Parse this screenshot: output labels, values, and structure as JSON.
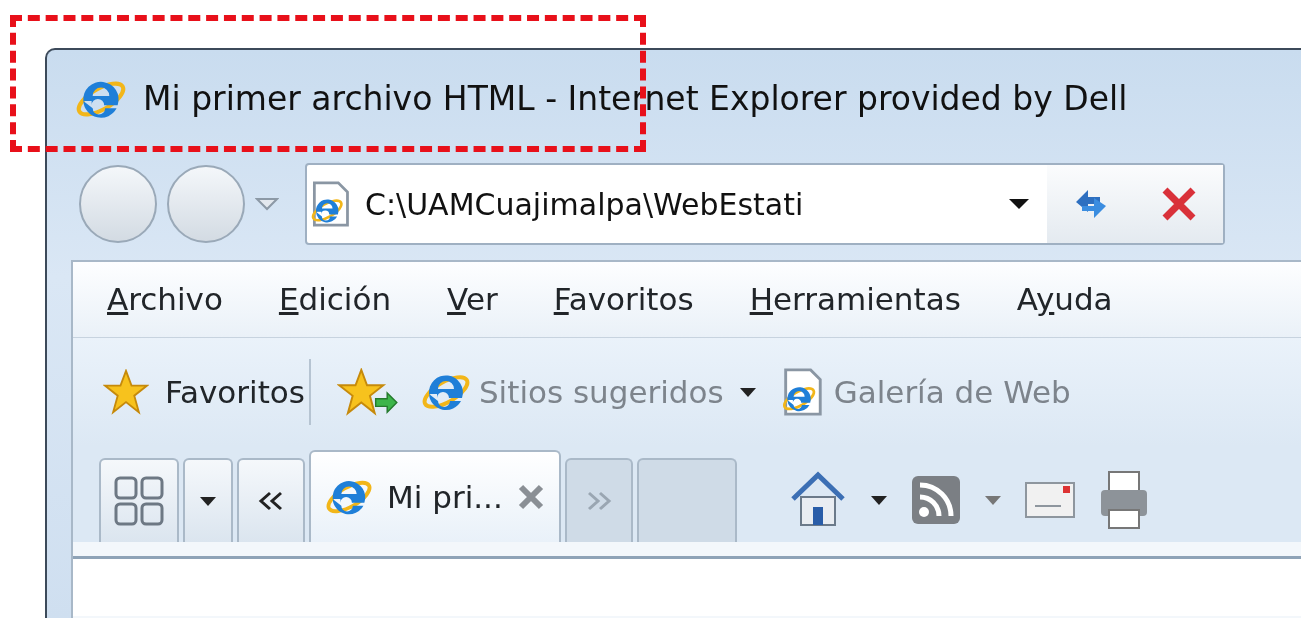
{
  "annotation": {
    "kind": "dashed-box"
  },
  "window": {
    "title": "Mi primer archivo HTML - Internet Explorer provided by Dell"
  },
  "address_bar": {
    "value": "C:\\UAMCuajimalpa\\WebEstati"
  },
  "menu": [
    {
      "key": "A",
      "after": "rchivo"
    },
    {
      "key": "E",
      "after": "dición"
    },
    {
      "key": "V",
      "after": "er"
    },
    {
      "key": "F",
      "after": "avoritos"
    },
    {
      "key": "H",
      "after": "erramientas"
    },
    {
      "before": "A",
      "key": "y",
      "after": "uda"
    }
  ],
  "favorites_bar": [
    {
      "kind": "favorites",
      "label": "Favoritos"
    },
    {
      "kind": "add-favorite"
    },
    {
      "kind": "suggested-sites",
      "label": "Sitios sugeridos"
    },
    {
      "kind": "web-slice",
      "label": "Galería de Web"
    }
  ],
  "tabs": [
    {
      "label": "Mi pri...",
      "selected": true
    }
  ]
}
